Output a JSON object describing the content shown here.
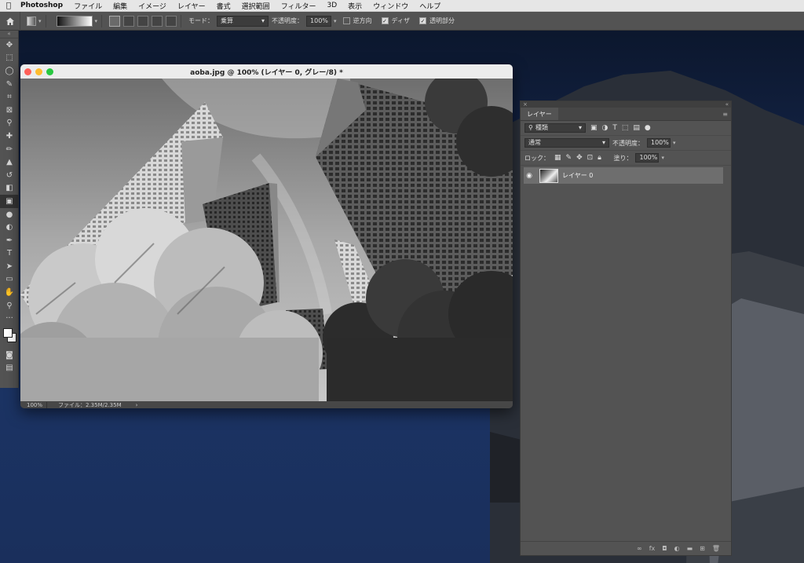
{
  "menubar": {
    "app_name": "Photoshop",
    "items": [
      "ファイル",
      "編集",
      "イメージ",
      "レイヤー",
      "書式",
      "選択範囲",
      "フィルター",
      "3D",
      "表示",
      "ウィンドウ",
      "ヘルプ"
    ]
  },
  "options": {
    "mode_label": "モード：",
    "mode_value": "乗算",
    "opacity_label": "不透明度：",
    "opacity_value": "100%",
    "reverse_label": "逆方向",
    "dither_label": "ディザ",
    "transparency_label": "透明部分"
  },
  "document": {
    "title": "aoba.jpg @ 100% (レイヤー 0, グレー/8) *",
    "zoom": "100%",
    "file_info": "ファイル：2.35M/2.35M",
    "status_arrow": "›"
  },
  "layers_panel": {
    "tab": "レイヤー",
    "filter_value": "種類",
    "blend_mode": "通常",
    "opacity_label": "不透明度：",
    "opacity_value": "100%",
    "lock_label": "ロック：",
    "fill_label": "塗り：",
    "fill_value": "100%",
    "layers": [
      {
        "name": "レイヤー 0",
        "visible": true
      }
    ]
  },
  "colors": {
    "ps_panel": "#535353",
    "ps_dark": "#3a3a3a",
    "traffic_red": "#ff5f57",
    "traffic_yellow": "#febc2e",
    "traffic_green": "#28c840"
  }
}
